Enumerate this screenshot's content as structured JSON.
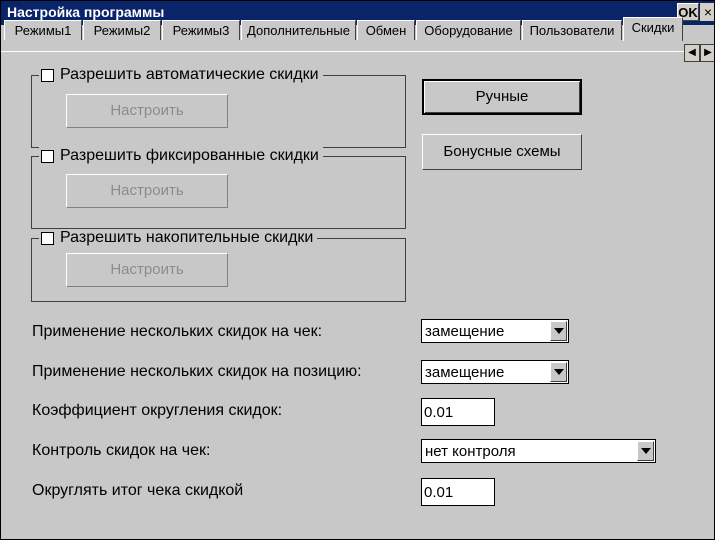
{
  "window": {
    "title": "Настройка программы",
    "ok_label": "OK",
    "close_label": "×"
  },
  "tabs": [
    {
      "label": "Режимы1"
    },
    {
      "label": "Режимы2"
    },
    {
      "label": "Режимы3"
    },
    {
      "label": "Дополнительные"
    },
    {
      "label": "Обмен"
    },
    {
      "label": "Оборудование"
    },
    {
      "label": "Пользователи"
    },
    {
      "label": "Скидки",
      "active": true
    }
  ],
  "groups": {
    "auto": {
      "label": "Разрешить автоматические скидки",
      "checked": false,
      "button": "Настроить"
    },
    "fixed": {
      "label": "Разрешить фиксированные скидки",
      "checked": false,
      "button": "Настроить"
    },
    "accum": {
      "label": "Разрешить накопительные скидки",
      "checked": false,
      "button": "Настроить"
    }
  },
  "buttons": {
    "manual": "Ручные",
    "bonus": "Бонусные схемы"
  },
  "settings": {
    "multi_check_label": "Применение нескольких скидок на чек:",
    "multi_check_value": "замещение",
    "multi_pos_label": "Применение нескольких скидок на позицию:",
    "multi_pos_value": "замещение",
    "round_coef_label": "Коэффициент округления скидок:",
    "round_coef_value": "0.01",
    "check_control_label": "Контроль скидок на чек:",
    "check_control_value": "нет контроля",
    "round_total_label": "Округлять итог чека скидкой",
    "round_total_value": "0.01"
  }
}
